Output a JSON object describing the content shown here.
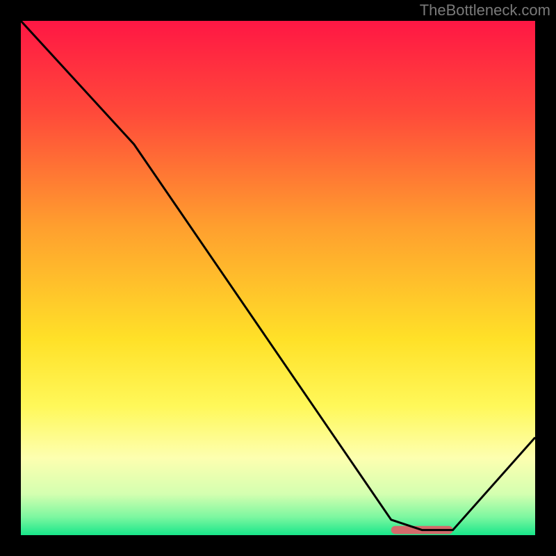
{
  "watermark": "TheBottleneck.com",
  "chart_data": {
    "type": "line",
    "title": "",
    "xlabel": "",
    "ylabel": "",
    "xlim": [
      0,
      100
    ],
    "ylim": [
      0,
      100
    ],
    "grid": false,
    "series": [
      {
        "name": "curve",
        "x": [
          0,
          22,
          72,
          78,
          84,
          100
        ],
        "values": [
          100,
          76,
          3,
          1,
          1,
          19
        ]
      }
    ],
    "marker": {
      "color": "#d36b6b",
      "x_range": [
        72,
        84
      ],
      "y": 1,
      "thickness_pct": 1.6
    },
    "background_gradient": {
      "stops": [
        {
          "pct": 0,
          "color": "#ff1744"
        },
        {
          "pct": 18,
          "color": "#ff4a3a"
        },
        {
          "pct": 40,
          "color": "#ff9f2e"
        },
        {
          "pct": 62,
          "color": "#ffe128"
        },
        {
          "pct": 75,
          "color": "#fff85a"
        },
        {
          "pct": 85,
          "color": "#fdffb0"
        },
        {
          "pct": 92,
          "color": "#d4ffb0"
        },
        {
          "pct": 96.5,
          "color": "#7cf7a0"
        },
        {
          "pct": 100,
          "color": "#18e68a"
        }
      ]
    }
  }
}
